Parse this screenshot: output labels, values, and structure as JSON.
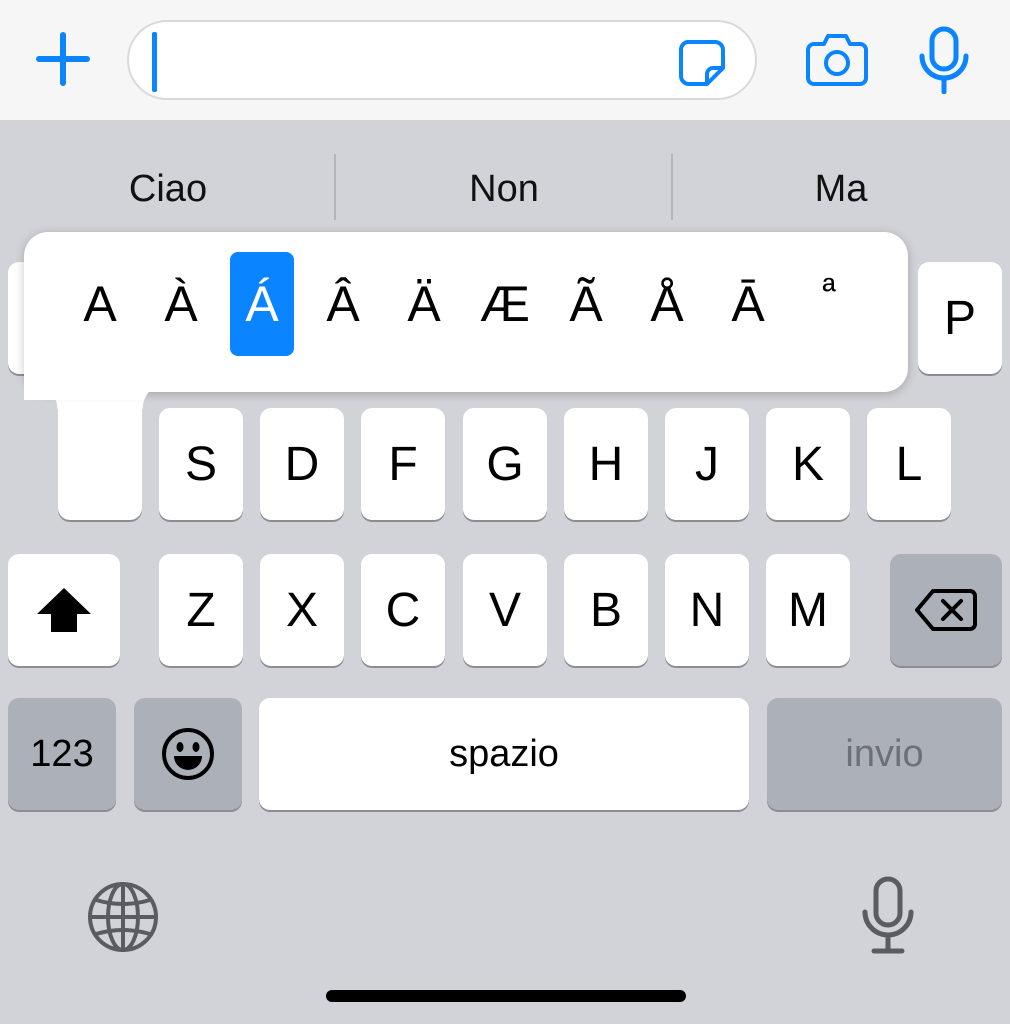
{
  "compose": {
    "plus_icon": "plus-icon",
    "sticker_icon": "sticker-icon",
    "camera_icon": "camera-icon",
    "mic_icon": "microphone-icon",
    "input_value": "",
    "accent_color": "#0a84ff"
  },
  "suggestions": [
    "Ciao",
    "Non",
    "Ma"
  ],
  "accent_popup": {
    "options": [
      "A",
      "À",
      "Á",
      "Â",
      "Ä",
      "Æ",
      "Ã",
      "Å",
      "Ā",
      "ª"
    ],
    "selected": "Á"
  },
  "keys": {
    "row1_visible": [
      "P"
    ],
    "row2": [
      "S",
      "D",
      "F",
      "G",
      "H",
      "J",
      "K",
      "L"
    ],
    "row3": [
      "Z",
      "X",
      "C",
      "V",
      "B",
      "N",
      "M"
    ],
    "shift_icon": "shift-icon",
    "delete_icon": "delete-icon",
    "numbers": "123",
    "emoji_icon": "emoji-icon",
    "space": "spazio",
    "return": "invio"
  },
  "bottom": {
    "globe_icon": "globe-icon",
    "dictation_icon": "microphone-icon"
  }
}
